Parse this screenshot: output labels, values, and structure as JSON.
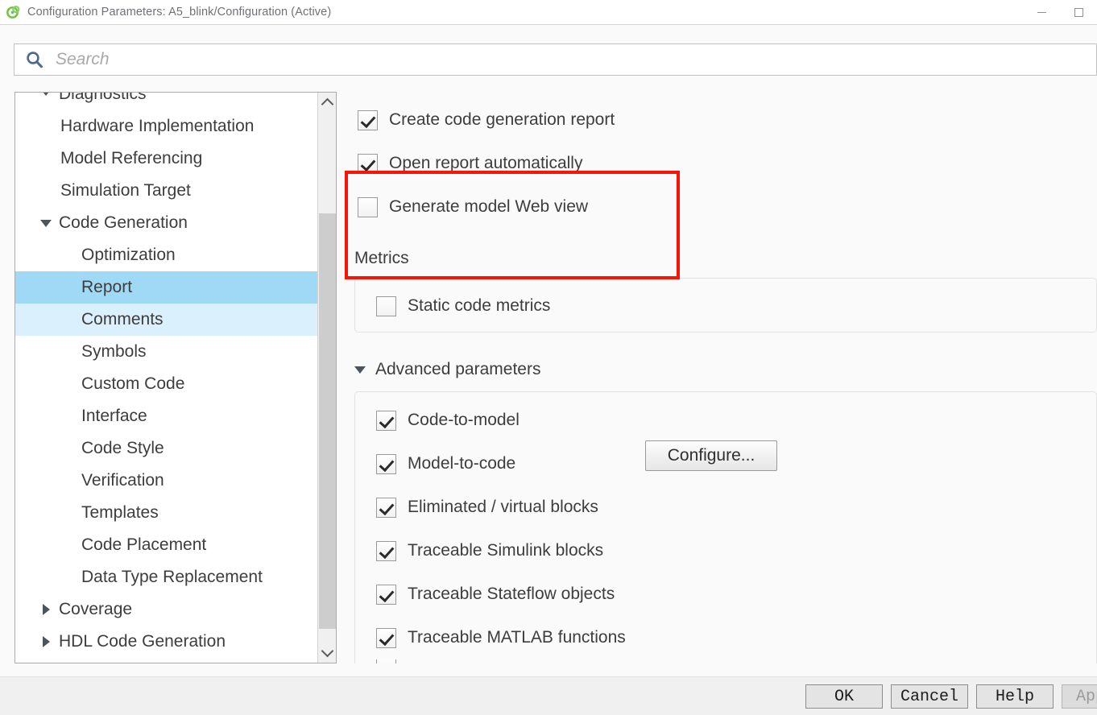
{
  "window": {
    "title": "Configuration Parameters: A5_blink/Configuration (Active)",
    "icon": "simulink-icon",
    "minimize_label": "Minimize",
    "maximize_label": "Maximize"
  },
  "search": {
    "placeholder": "Search",
    "value": "",
    "icon": "search-icon"
  },
  "tree": {
    "items": [
      {
        "label": "Diagnostics",
        "level": 0,
        "twisty": "down",
        "state": "clipped"
      },
      {
        "label": "Hardware Implementation",
        "level": 1,
        "twisty": "none",
        "state": "normal"
      },
      {
        "label": "Model Referencing",
        "level": 1,
        "twisty": "none",
        "state": "normal"
      },
      {
        "label": "Simulation Target",
        "level": 1,
        "twisty": "none",
        "state": "normal"
      },
      {
        "label": "Code Generation",
        "level": 0,
        "twisty": "down",
        "state": "normal"
      },
      {
        "label": "Optimization",
        "level": 2,
        "twisty": "none",
        "state": "normal"
      },
      {
        "label": "Report",
        "level": 2,
        "twisty": "none",
        "state": "selected"
      },
      {
        "label": "Comments",
        "level": 2,
        "twisty": "none",
        "state": "hovered"
      },
      {
        "label": "Symbols",
        "level": 2,
        "twisty": "none",
        "state": "normal"
      },
      {
        "label": "Custom Code",
        "level": 2,
        "twisty": "none",
        "state": "normal"
      },
      {
        "label": "Interface",
        "level": 2,
        "twisty": "none",
        "state": "normal"
      },
      {
        "label": "Code Style",
        "level": 2,
        "twisty": "none",
        "state": "normal"
      },
      {
        "label": "Verification",
        "level": 2,
        "twisty": "none",
        "state": "normal"
      },
      {
        "label": "Templates",
        "level": 2,
        "twisty": "none",
        "state": "normal"
      },
      {
        "label": "Code Placement",
        "level": 2,
        "twisty": "none",
        "state": "normal"
      },
      {
        "label": "Data Type Replacement",
        "level": 2,
        "twisty": "none",
        "state": "normal"
      },
      {
        "label": "Coverage",
        "level": 0,
        "twisty": "right",
        "state": "normal"
      },
      {
        "label": "HDL Code Generation",
        "level": 0,
        "twisty": "right",
        "state": "normal"
      }
    ],
    "scrollbar": {
      "up_icon": "chevron-up-icon",
      "down_icon": "chevron-down-icon"
    }
  },
  "content": {
    "report_options": [
      {
        "label": "Create code generation report",
        "checked": true,
        "highlighted": true
      },
      {
        "label": "Open report automatically",
        "checked": true,
        "highlighted": true
      },
      {
        "label": "Generate model Web view",
        "checked": false,
        "highlighted": false
      }
    ],
    "metrics": {
      "title": "Metrics",
      "options": [
        {
          "label": "Static code metrics",
          "checked": false
        }
      ]
    },
    "advanced": {
      "title": "Advanced parameters",
      "expanded": true,
      "options": [
        {
          "label": "Code-to-model",
          "checked": true
        },
        {
          "label": "Model-to-code",
          "checked": true
        },
        {
          "label": "Eliminated / virtual blocks",
          "checked": true
        },
        {
          "label": "Traceable Simulink blocks",
          "checked": true
        },
        {
          "label": "Traceable Stateflow objects",
          "checked": true
        },
        {
          "label": "Traceable MATLAB functions",
          "checked": true
        }
      ],
      "configure_button": "Configure..."
    },
    "annotation_color": "#fa1405"
  },
  "footer": {
    "buttons": [
      {
        "label": "OK",
        "disabled": false
      },
      {
        "label": "Cancel",
        "disabled": false
      },
      {
        "label": "Help",
        "disabled": false
      },
      {
        "label": "Apply",
        "disabled": true
      }
    ]
  }
}
